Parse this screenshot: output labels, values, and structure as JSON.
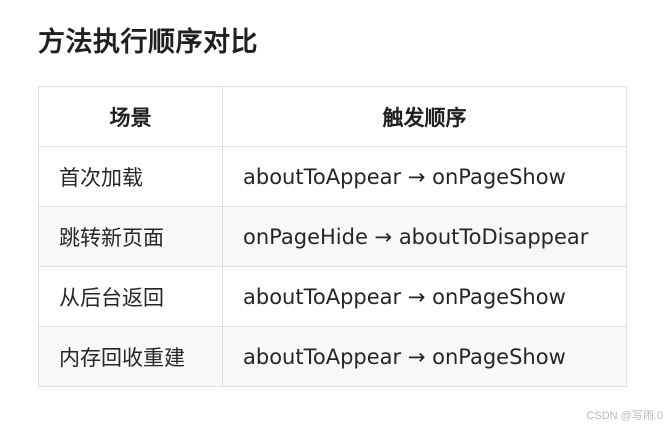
{
  "title": "方法执行顺序对比",
  "table": {
    "headers": [
      "场景",
      "触发顺序"
    ],
    "rows": [
      {
        "scene": "首次加载",
        "order": "aboutToAppear → onPageShow"
      },
      {
        "scene": "跳转新页面",
        "order": "onPageHide → aboutToDisappear"
      },
      {
        "scene": "从后台返回",
        "order": "aboutToAppear → onPageShow"
      },
      {
        "scene": "内存回收重建",
        "order": "aboutToAppear → onPageShow"
      }
    ]
  },
  "watermark": "CSDN @写雨.0"
}
